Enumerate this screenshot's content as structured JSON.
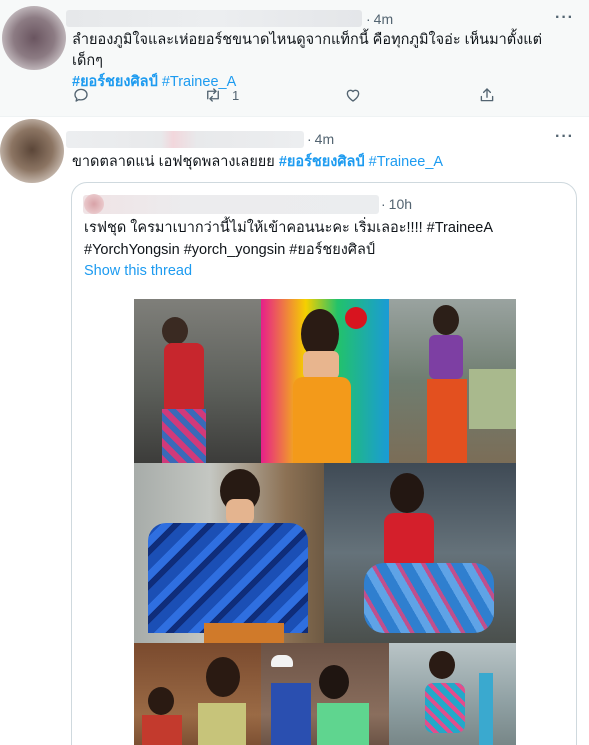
{
  "tweets": [
    {
      "time": "4m",
      "text": "ลำยองภูมิใจและเห่อยอร์ชขนาดไหนดูจากแท็กนี้ คือทุกภูมิใจอ่ะ เห็นมาตั้งแต่เด็กๆ",
      "hashtags": [
        "#ยอร์ชยงศิลป์",
        "#Trainee_A"
      ],
      "retweet_count": "1",
      "icons": {
        "more": "more-icon",
        "reply": "reply-icon",
        "retweet": "retweet-icon",
        "like": "like-icon",
        "share": "share-icon"
      }
    },
    {
      "time": "4m",
      "text": "ขาดตลาดแน่ เอฟชุดพลางเลยยย",
      "hashtags": [
        "#ยอร์ชยงศิลป์",
        "#Trainee_A"
      ],
      "quote": {
        "time": "10h",
        "line1": "เรฟชุด ใครมาเบากว่านี้ไม่ให้เข้าคอนนะคะ เริ่มเลอะ!!!! #TraineeA",
        "line2": "#YorchYongsin #yorch_yongsin #ยอร์ชยงศิลป์",
        "show_thread": "Show this thread"
      }
    }
  ],
  "colors": {
    "link": "#1d9bf0",
    "muted": "#536471",
    "text": "#0f1419",
    "border": "#cfd9de"
  }
}
